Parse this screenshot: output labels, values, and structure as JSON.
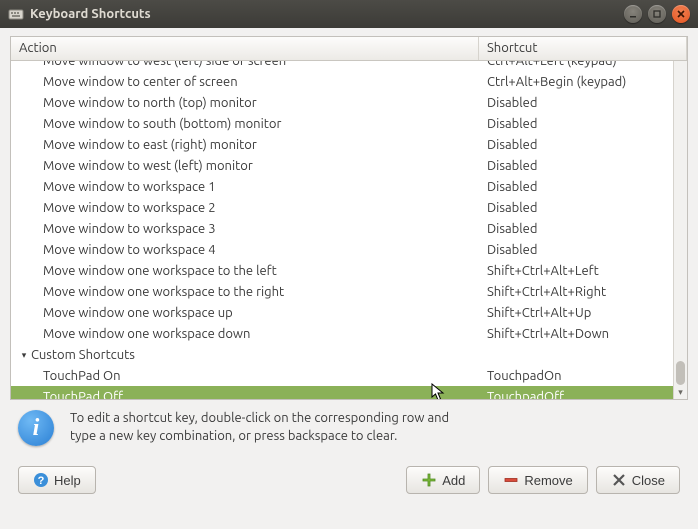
{
  "window": {
    "title": "Keyboard Shortcuts"
  },
  "columns": {
    "action": "Action",
    "shortcut": "Shortcut"
  },
  "rows": [
    {
      "action": "Move window to west (left) side of screen",
      "shortcut": "Ctrl+Alt+Left (keypad)",
      "partial": true
    },
    {
      "action": "Move window to center of screen",
      "shortcut": "Ctrl+Alt+Begin (keypad)"
    },
    {
      "action": "Move window to north (top) monitor",
      "shortcut": "Disabled"
    },
    {
      "action": "Move window to south (bottom) monitor",
      "shortcut": "Disabled"
    },
    {
      "action": "Move window to east (right) monitor",
      "shortcut": "Disabled"
    },
    {
      "action": "Move window to west (left) monitor",
      "shortcut": "Disabled"
    },
    {
      "action": "Move window to workspace 1",
      "shortcut": "Disabled"
    },
    {
      "action": "Move window to workspace 2",
      "shortcut": "Disabled"
    },
    {
      "action": "Move window to workspace 3",
      "shortcut": "Disabled"
    },
    {
      "action": "Move window to workspace 4",
      "shortcut": "Disabled"
    },
    {
      "action": "Move window one workspace to the left",
      "shortcut": "Shift+Ctrl+Alt+Left"
    },
    {
      "action": "Move window one workspace to the right",
      "shortcut": "Shift+Ctrl+Alt+Right"
    },
    {
      "action": "Move window one workspace up",
      "shortcut": "Shift+Ctrl+Alt+Up"
    },
    {
      "action": "Move window one workspace down",
      "shortcut": "Shift+Ctrl+Alt+Down"
    },
    {
      "action": "Custom Shortcuts",
      "shortcut": "",
      "category": true
    },
    {
      "action": "TouchPad On",
      "shortcut": "TouchpadOn"
    },
    {
      "action": "TouchPad Off",
      "shortcut": "TouchpadOff",
      "selected": true
    }
  ],
  "info": {
    "line1": "To edit a shortcut key, double-click on the corresponding row and",
    "line2": "type a new key combination, or press backspace to clear."
  },
  "buttons": {
    "help": "Help",
    "add": "Add",
    "remove": "Remove",
    "close": "Close"
  }
}
